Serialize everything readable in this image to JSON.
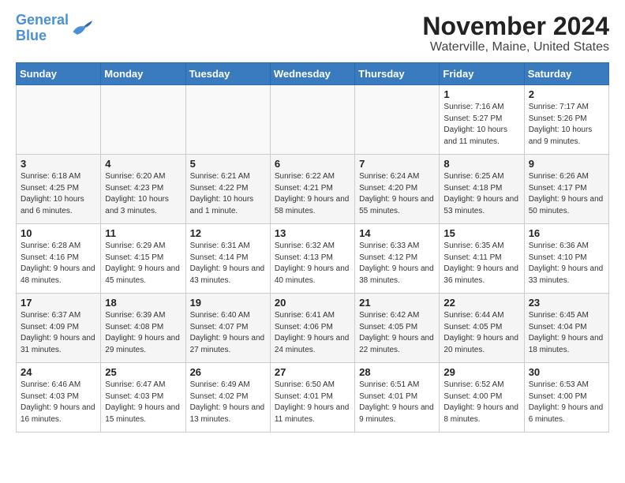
{
  "header": {
    "logo_line1": "General",
    "logo_line2": "Blue",
    "title": "November 2024",
    "subtitle": "Waterville, Maine, United States"
  },
  "columns": [
    "Sunday",
    "Monday",
    "Tuesday",
    "Wednesday",
    "Thursday",
    "Friday",
    "Saturday"
  ],
  "weeks": [
    [
      {
        "day": "",
        "info": ""
      },
      {
        "day": "",
        "info": ""
      },
      {
        "day": "",
        "info": ""
      },
      {
        "day": "",
        "info": ""
      },
      {
        "day": "",
        "info": ""
      },
      {
        "day": "1",
        "info": "Sunrise: 7:16 AM\nSunset: 5:27 PM\nDaylight: 10 hours and 11 minutes."
      },
      {
        "day": "2",
        "info": "Sunrise: 7:17 AM\nSunset: 5:26 PM\nDaylight: 10 hours and 9 minutes."
      }
    ],
    [
      {
        "day": "3",
        "info": "Sunrise: 6:18 AM\nSunset: 4:25 PM\nDaylight: 10 hours and 6 minutes."
      },
      {
        "day": "4",
        "info": "Sunrise: 6:20 AM\nSunset: 4:23 PM\nDaylight: 10 hours and 3 minutes."
      },
      {
        "day": "5",
        "info": "Sunrise: 6:21 AM\nSunset: 4:22 PM\nDaylight: 10 hours and 1 minute."
      },
      {
        "day": "6",
        "info": "Sunrise: 6:22 AM\nSunset: 4:21 PM\nDaylight: 9 hours and 58 minutes."
      },
      {
        "day": "7",
        "info": "Sunrise: 6:24 AM\nSunset: 4:20 PM\nDaylight: 9 hours and 55 minutes."
      },
      {
        "day": "8",
        "info": "Sunrise: 6:25 AM\nSunset: 4:18 PM\nDaylight: 9 hours and 53 minutes."
      },
      {
        "day": "9",
        "info": "Sunrise: 6:26 AM\nSunset: 4:17 PM\nDaylight: 9 hours and 50 minutes."
      }
    ],
    [
      {
        "day": "10",
        "info": "Sunrise: 6:28 AM\nSunset: 4:16 PM\nDaylight: 9 hours and 48 minutes."
      },
      {
        "day": "11",
        "info": "Sunrise: 6:29 AM\nSunset: 4:15 PM\nDaylight: 9 hours and 45 minutes."
      },
      {
        "day": "12",
        "info": "Sunrise: 6:31 AM\nSunset: 4:14 PM\nDaylight: 9 hours and 43 minutes."
      },
      {
        "day": "13",
        "info": "Sunrise: 6:32 AM\nSunset: 4:13 PM\nDaylight: 9 hours and 40 minutes."
      },
      {
        "day": "14",
        "info": "Sunrise: 6:33 AM\nSunset: 4:12 PM\nDaylight: 9 hours and 38 minutes."
      },
      {
        "day": "15",
        "info": "Sunrise: 6:35 AM\nSunset: 4:11 PM\nDaylight: 9 hours and 36 minutes."
      },
      {
        "day": "16",
        "info": "Sunrise: 6:36 AM\nSunset: 4:10 PM\nDaylight: 9 hours and 33 minutes."
      }
    ],
    [
      {
        "day": "17",
        "info": "Sunrise: 6:37 AM\nSunset: 4:09 PM\nDaylight: 9 hours and 31 minutes."
      },
      {
        "day": "18",
        "info": "Sunrise: 6:39 AM\nSunset: 4:08 PM\nDaylight: 9 hours and 29 minutes."
      },
      {
        "day": "19",
        "info": "Sunrise: 6:40 AM\nSunset: 4:07 PM\nDaylight: 9 hours and 27 minutes."
      },
      {
        "day": "20",
        "info": "Sunrise: 6:41 AM\nSunset: 4:06 PM\nDaylight: 9 hours and 24 minutes."
      },
      {
        "day": "21",
        "info": "Sunrise: 6:42 AM\nSunset: 4:05 PM\nDaylight: 9 hours and 22 minutes."
      },
      {
        "day": "22",
        "info": "Sunrise: 6:44 AM\nSunset: 4:05 PM\nDaylight: 9 hours and 20 minutes."
      },
      {
        "day": "23",
        "info": "Sunrise: 6:45 AM\nSunset: 4:04 PM\nDaylight: 9 hours and 18 minutes."
      }
    ],
    [
      {
        "day": "24",
        "info": "Sunrise: 6:46 AM\nSunset: 4:03 PM\nDaylight: 9 hours and 16 minutes."
      },
      {
        "day": "25",
        "info": "Sunrise: 6:47 AM\nSunset: 4:03 PM\nDaylight: 9 hours and 15 minutes."
      },
      {
        "day": "26",
        "info": "Sunrise: 6:49 AM\nSunset: 4:02 PM\nDaylight: 9 hours and 13 minutes."
      },
      {
        "day": "27",
        "info": "Sunrise: 6:50 AM\nSunset: 4:01 PM\nDaylight: 9 hours and 11 minutes."
      },
      {
        "day": "28",
        "info": "Sunrise: 6:51 AM\nSunset: 4:01 PM\nDaylight: 9 hours and 9 minutes."
      },
      {
        "day": "29",
        "info": "Sunrise: 6:52 AM\nSunset: 4:00 PM\nDaylight: 9 hours and 8 minutes."
      },
      {
        "day": "30",
        "info": "Sunrise: 6:53 AM\nSunset: 4:00 PM\nDaylight: 9 hours and 6 minutes."
      }
    ]
  ]
}
